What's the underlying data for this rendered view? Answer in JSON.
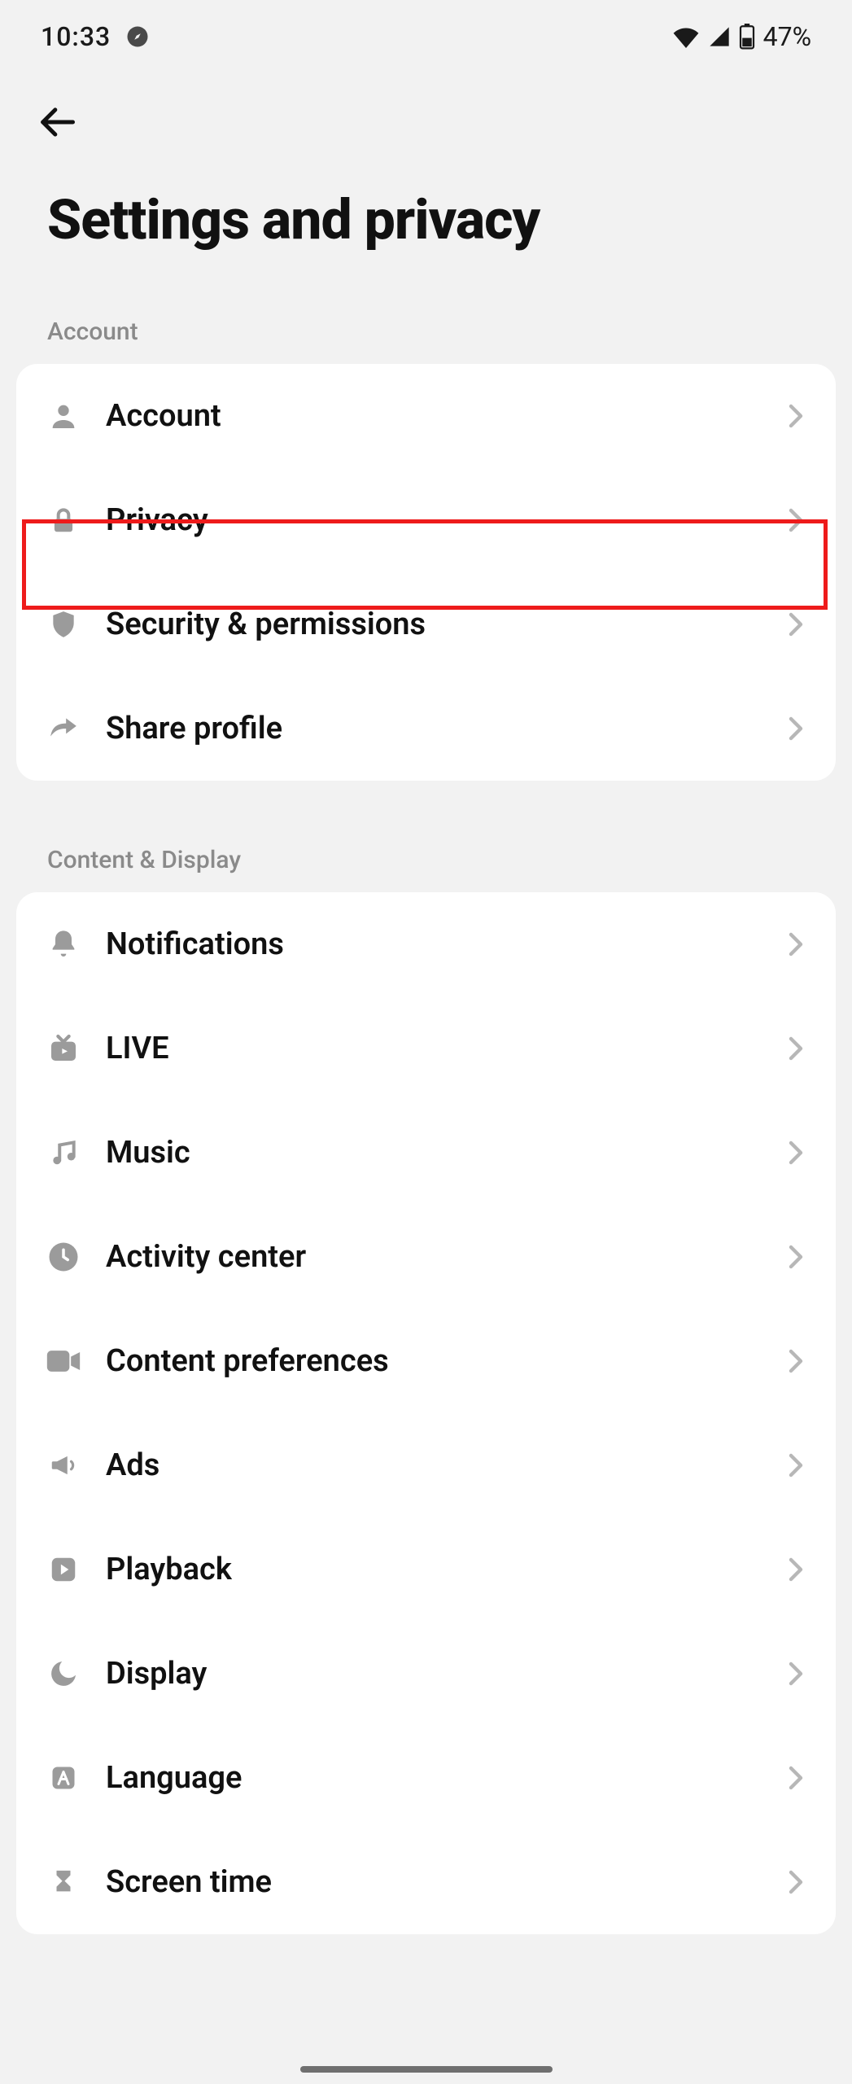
{
  "status": {
    "time": "10:33",
    "battery": "47%"
  },
  "page": {
    "title": "Settings and privacy"
  },
  "sections": {
    "account": {
      "header": "Account",
      "items": [
        {
          "label": "Account"
        },
        {
          "label": "Privacy"
        },
        {
          "label": "Security & permissions"
        },
        {
          "label": "Share profile"
        }
      ]
    },
    "content_display": {
      "header": "Content & Display",
      "items": [
        {
          "label": "Notifications"
        },
        {
          "label": "LIVE"
        },
        {
          "label": "Music"
        },
        {
          "label": "Activity center"
        },
        {
          "label": "Content preferences"
        },
        {
          "label": "Ads"
        },
        {
          "label": "Playback"
        },
        {
          "label": "Display"
        },
        {
          "label": "Language"
        },
        {
          "label": "Screen time"
        }
      ]
    }
  }
}
